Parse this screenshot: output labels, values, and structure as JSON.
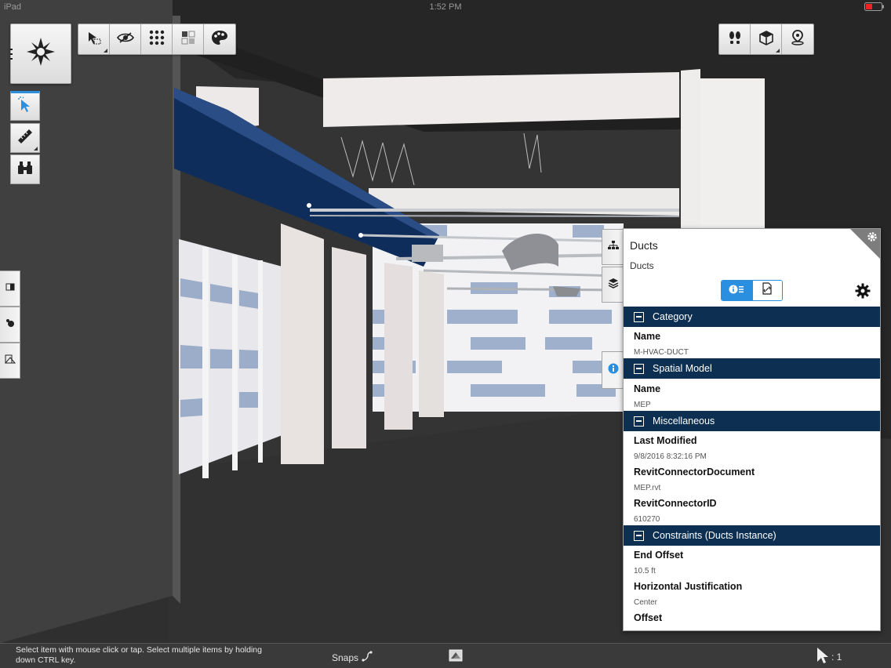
{
  "status_bar": {
    "device": "iPad",
    "time": "1:52 PM"
  },
  "colors": {
    "accent": "#2b8fe0",
    "section_header": "#0d2f52",
    "duct_blue": "#0f2d5a"
  },
  "toolbar": {
    "navigate_icon": "compass-star-icon",
    "top_left": [
      "select-lasso-icon",
      "eye-slash-icon",
      "dot-grid-icon",
      "squares-icon",
      "palette-icon"
    ],
    "left_vertical": [
      "pointer-select-icon",
      "ruler-icon",
      "binoculars-icon"
    ],
    "top_right": [
      "footsteps-icon",
      "cube-icon",
      "location-pin-icon"
    ],
    "side": [
      "split-view-icon",
      "nodes-icon",
      "warning-icon"
    ]
  },
  "panel": {
    "title": "Ducts",
    "subtitle": "Ducts",
    "sections": [
      {
        "header": "Category",
        "props": [
          {
            "label": "Name",
            "value": "M-HVAC-DUCT"
          }
        ]
      },
      {
        "header": "Spatial Model",
        "props": [
          {
            "label": "Name",
            "value": "MEP"
          }
        ]
      },
      {
        "header": "Miscellaneous",
        "props": [
          {
            "label": "Last Modified",
            "value": "9/8/2016 8:32:16 PM"
          },
          {
            "label": "RevitConnectorDocument",
            "value": "MEP.rvt"
          },
          {
            "label": "RevitConnectorID",
            "value": "610270"
          }
        ]
      },
      {
        "header": "Constraints (Ducts Instance)",
        "props": [
          {
            "label": "End Offset",
            "value": "10.5 ft"
          },
          {
            "label": "Horizontal Justification",
            "value": "Center"
          },
          {
            "label": "Offset",
            "value": ""
          }
        ]
      }
    ]
  },
  "bottom_bar": {
    "hint": "Select item with mouse click or tap. Select multiple items by holding down CTRL key.",
    "snaps_label": "Snaps",
    "selection_count": ": 1"
  }
}
